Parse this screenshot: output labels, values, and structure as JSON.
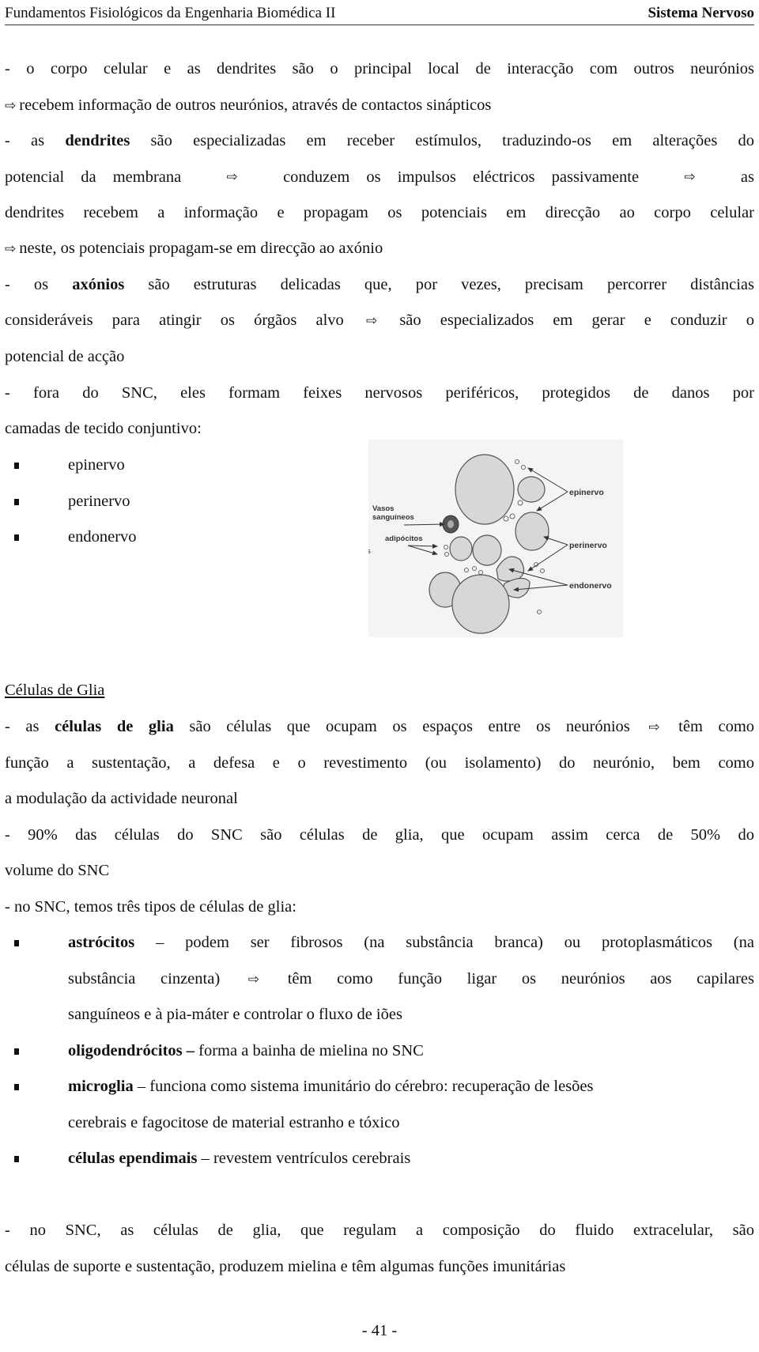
{
  "header": {
    "course_title": "Fundamentos Fisiológicos da Engenharia Biomédica II",
    "section_title": "Sistema Nervoso"
  },
  "arrow_glyph": "⇨",
  "paragraphs": {
    "p1": {
      "l1": "- o corpo celular e as dendrites são o principal local de interacção com outros neurónios",
      "l2": "recebem informação de outros neurónios, através de contactos sinápticos"
    },
    "p2": {
      "l1_pre": "- as ",
      "l1_bold": "dendrites",
      "l1_post": " são especializadas em receber estímulos, traduzindo-os em alterações do",
      "l2_a": "potencial da membrana",
      "l2_b": "conduzem os impulsos eléctricos passivamente",
      "l2_c": "as",
      "l3": "dendrites recebem a informação e propagam os potenciais em direcção ao corpo celular",
      "l4": "neste, os potenciais propagam-se em direcção ao axónio"
    },
    "p3": {
      "l1_pre": "- os ",
      "l1_bold": "axónios",
      "l1_post": " são estruturas delicadas que, por vezes, precisam percorrer distâncias",
      "l2_a": "consideráveis para atingir os órgãos alvo",
      "l2_b": "são especializados em gerar e conduzir o",
      "l3": "potencial de acção"
    },
    "p4": {
      "l1": "- fora do SNC, eles formam feixes nervosos periféricos, protegidos de danos por",
      "l2": "camadas de tecido conjuntivo:",
      "bullets": [
        "epinervo",
        "perinervo",
        "endonervo"
      ]
    }
  },
  "figure": {
    "labels": {
      "vasos": "Vasos",
      "sanguineos": "sanguíneos",
      "adipocitos": "adipócitos",
      "epinervo": "epinervo",
      "perinervo": "perinervo",
      "endonervo": "endonervo",
      "stray": "s"
    }
  },
  "glia": {
    "heading": "Células de Glia",
    "p1": {
      "l1_pre": "- as ",
      "l1_bold": "células de glia",
      "l1_post": " são células que ocupam os espaços entre os neurónios",
      "l1_end": "têm como",
      "l2": "função a sustentação, a defesa e o revestimento (ou isolamento) do neurónio, bem como",
      "l3": "a modulação da actividade neuronal"
    },
    "p2": {
      "l1": "- 90% das células do SNC são células de glia, que ocupam assim cerca de 50% do",
      "l2": "volume do SNC"
    },
    "p3": {
      "l1": "- no SNC, temos três tipos de células de glia:"
    },
    "types": [
      {
        "name": "astrócitos",
        "l1": " – podem ser fibrosos (na substância branca) ou protoplasmáticos (na",
        "l2_a": "substância cinzenta)",
        "l2_b": "têm como função ligar os neurónios aos capilares",
        "l3": "sanguíneos e à pia-máter e controlar o fluxo de iões"
      },
      {
        "name": "oligodendrócitos –",
        "l1": " forma a bainha de mielina no SNC"
      },
      {
        "name": "microglia",
        "l1": " – funciona como sistema imunitário do cérebro: recuperação de lesões",
        "l2": "cerebrais e fagocitose de material estranho e tóxico"
      },
      {
        "name": "células ependimais",
        "l1": " – revestem ventrículos cerebrais"
      }
    ],
    "p4": {
      "l1": "- no SNC, as células de glia, que regulam a composição do fluido extracelular, são",
      "l2": "células de suporte e sustentação, produzem mielina e têm algumas funções imunitárias"
    }
  },
  "footer": {
    "page_number": "- 41 -"
  }
}
